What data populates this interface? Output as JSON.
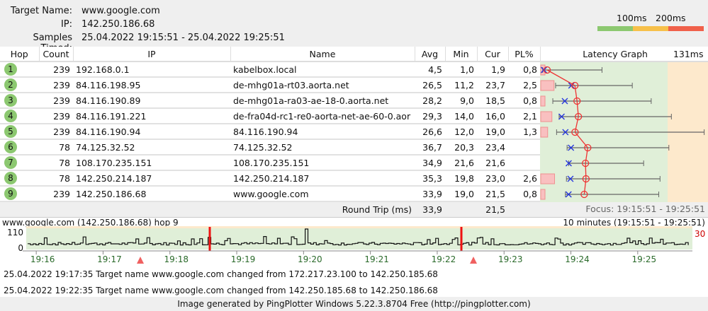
{
  "header": {
    "target_label": "Target Name:",
    "target": "www.google.com",
    "ip_label": "IP:",
    "ip": "142.250.186.68",
    "samples_label": "Samples Timed:",
    "samples": "25.04.2022 19:15:51 - 25.04.2022 19:25:51"
  },
  "legend": {
    "label_100": "100ms",
    "label_200": "200ms",
    "colors": [
      "#8cc870",
      "#f7c04a",
      "#f0604a"
    ]
  },
  "columns": [
    "Hop",
    "Count",
    "IP",
    "Name",
    "Avg",
    "Min",
    "Cur",
    "PL%",
    "Latency Graph"
  ],
  "graph_max_label": "131ms",
  "graph_max_ms": 131,
  "hops": [
    {
      "hop": "1",
      "count": "239",
      "ip": "192.168.0.1",
      "name": "kabelbox.local",
      "avg": "4,5",
      "min": "1,0",
      "cur": "1,9",
      "pl": "0,8",
      "max_ms": 48
    },
    {
      "hop": "2",
      "count": "239",
      "ip": "84.116.198.95",
      "name": "de-mhg01a-rt03.aorta.net",
      "avg": "26,5",
      "min": "11,2",
      "cur": "23,7",
      "pl": "2,5",
      "max_ms": 72
    },
    {
      "hop": "3",
      "count": "239",
      "ip": "84.116.190.89",
      "name": "de-mhg01a-ra03-ae-18-0.aorta.net",
      "avg": "28,2",
      "min": "9,0",
      "cur": "18,5",
      "pl": "0,8",
      "max_ms": 87
    },
    {
      "hop": "4",
      "count": "239",
      "ip": "84.116.191.221",
      "name": "de-fra04d-rc1-re0-aorta-net-ae-60-0.aor",
      "avg": "29,3",
      "min": "14,0",
      "cur": "16,0",
      "pl": "2,1",
      "max_ms": 103
    },
    {
      "hop": "5",
      "count": "239",
      "ip": "84.116.190.94",
      "name": "84.116.190.94",
      "avg": "26,6",
      "min": "12,0",
      "cur": "19,0",
      "pl": "1,3",
      "max_ms": 129
    },
    {
      "hop": "6",
      "count": "78",
      "ip": "74.125.32.52",
      "name": "74.125.32.52",
      "avg": "36,7",
      "min": "20,3",
      "cur": "23,4",
      "pl": "",
      "max_ms": 101
    },
    {
      "hop": "7",
      "count": "78",
      "ip": "108.170.235.151",
      "name": "108.170.235.151",
      "avg": "34,9",
      "min": "21,6",
      "cur": "21,6",
      "pl": "",
      "max_ms": 81
    },
    {
      "hop": "8",
      "count": "78",
      "ip": "142.250.214.187",
      "name": "142.250.214.187",
      "avg": "35,3",
      "min": "19,8",
      "cur": "23,0",
      "pl": "2,6",
      "max_ms": 94
    },
    {
      "hop": "9",
      "count": "239",
      "ip": "142.250.186.68",
      "name": "www.google.com",
      "avg": "33,9",
      "min": "19,0",
      "cur": "21,5",
      "pl": "0,8",
      "max_ms": 93
    }
  ],
  "round_trip": {
    "label": "Round Trip (ms)",
    "avg": "33,9",
    "cur": "21,5",
    "focus": "Focus: 19:15:51 - 19:25:51"
  },
  "history": {
    "title": "www.google.com (142.250.186.68) hop 9",
    "range": "10 minutes (19:15:51 - 19:25:51)",
    "y_max": "110",
    "y_min": "0",
    "pl_scale": "30",
    "ticks": [
      "19:16",
      "19:17",
      "19:18",
      "19:19",
      "19:20",
      "19:21",
      "19:22",
      "19:23",
      "19:24",
      "19:25"
    ]
  },
  "events": [
    "25.04.2022 19:17:35 Target name www.google.com changed from 172.217.23.100 to 142.250.185.68",
    "25.04.2022 19:22:35 Target name www.google.com changed from 142.250.185.68 to 142.250.186.68"
  ],
  "footer": "Image generated by PingPlotter Windows 5.22.3.8704 Free (http://pingplotter.com)"
}
